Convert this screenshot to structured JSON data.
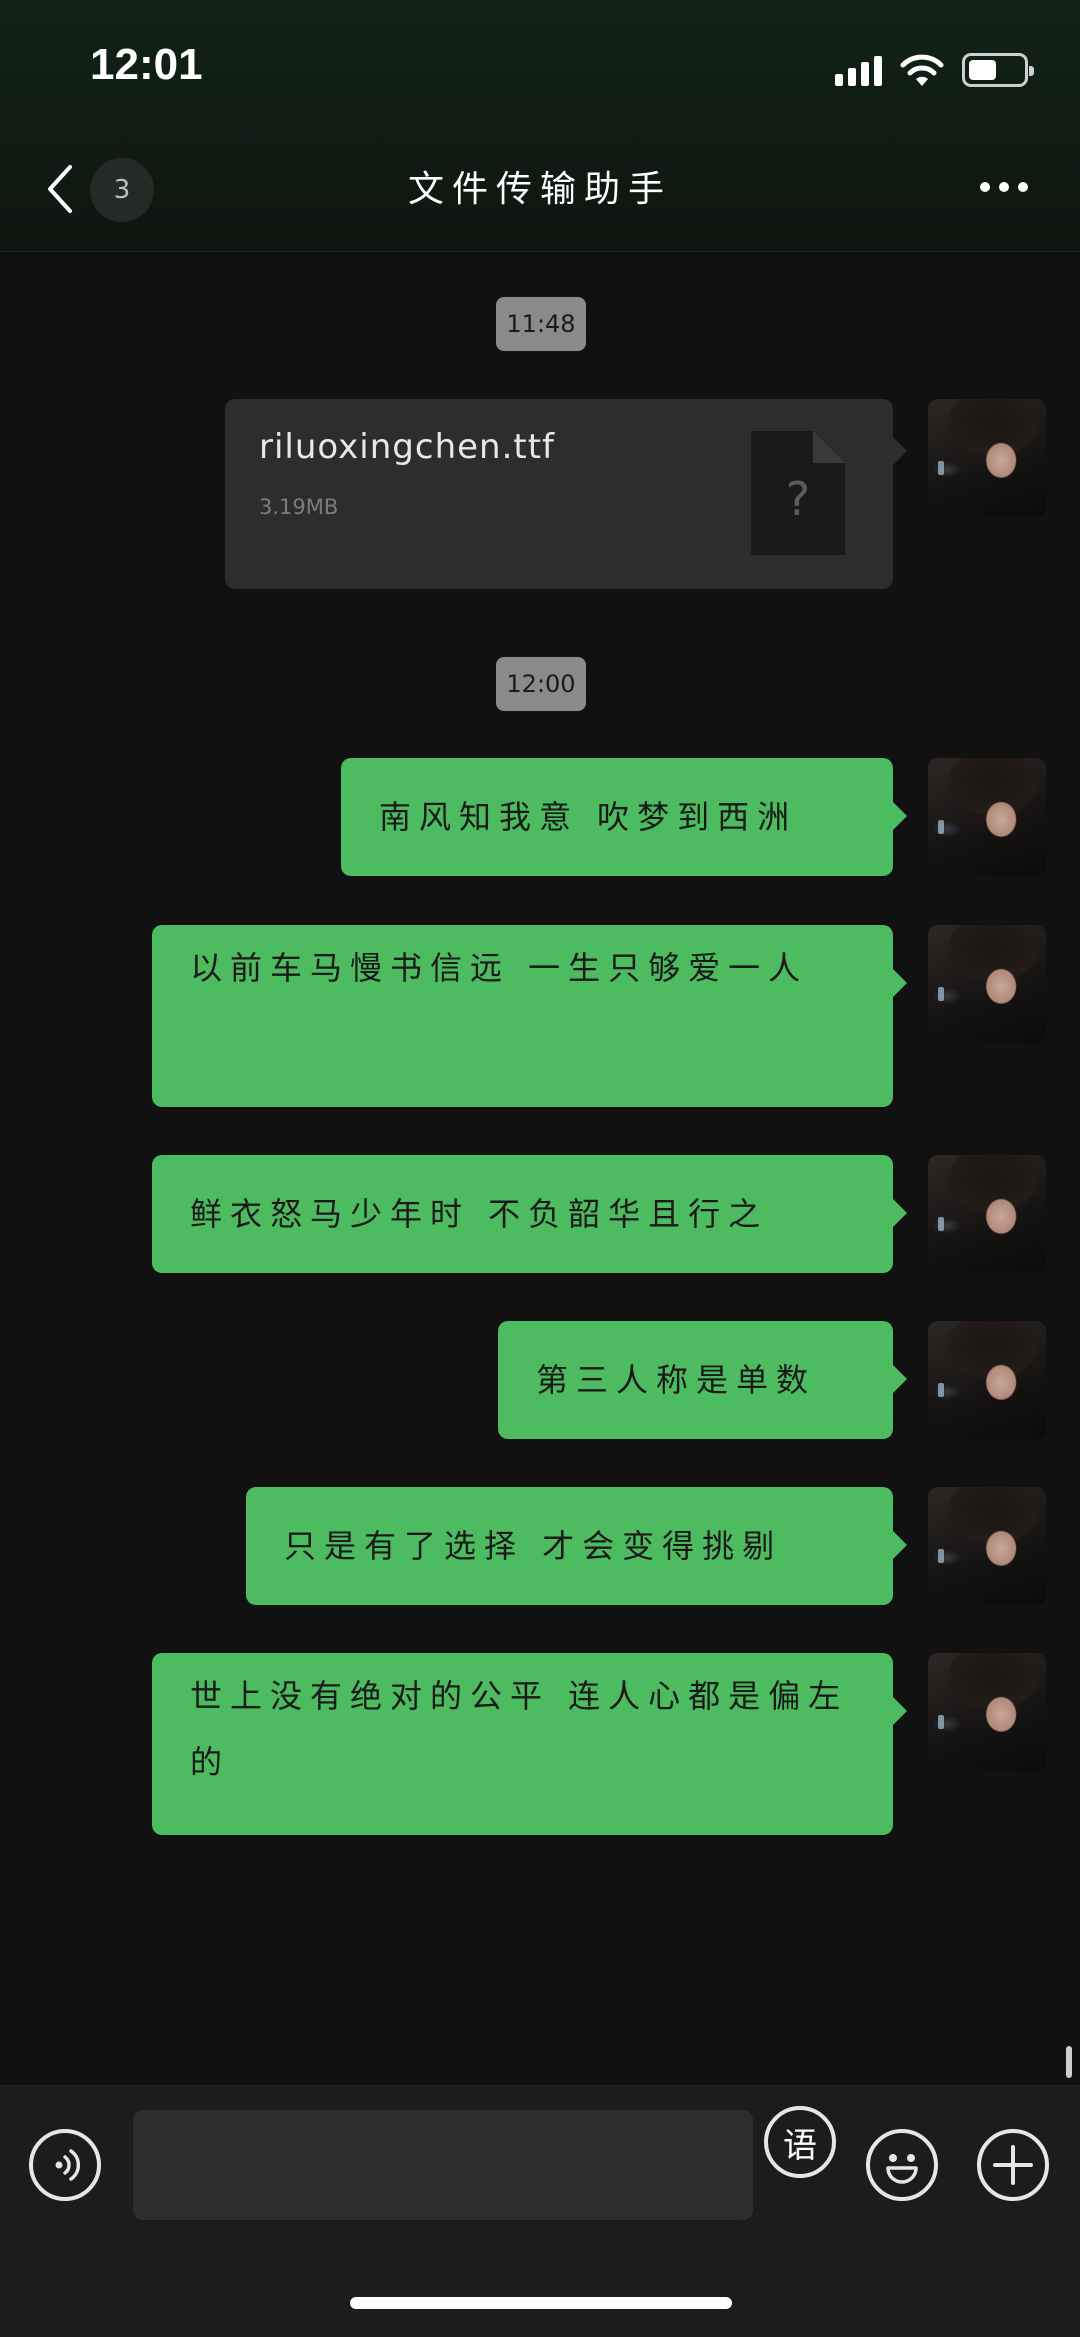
{
  "status_bar": {
    "time": "12:01"
  },
  "header": {
    "back_badge_count": "3",
    "title": "文件传输助手"
  },
  "messages": {
    "time_1": "11:48",
    "file": {
      "name": "riluoxingchen.ttf",
      "size": "3.19MB",
      "icon_symbol": "?"
    },
    "time_2": "12:00",
    "m1": "南风知我意 吹梦到西洲",
    "m2": "以前车马慢书信远 一生只够爱一人",
    "m3": "鲜衣怒马少年时 不负韶华且行之",
    "m4": "第三人称是单数",
    "m5": "只是有了选择 才会变得挑剔",
    "m6": "世上没有绝对的公平 连人心都是偏左的"
  },
  "input_bar": {
    "placeholder": "",
    "voice_to_text_label": "语"
  },
  "colors": {
    "bubble_green": "#4dbb5f",
    "background": "#111111",
    "file_card": "#2d2d2d"
  },
  "icons": [
    "back-chevron-icon",
    "more-dots-icon",
    "voice-icon",
    "emoji-icon",
    "plus-icon",
    "file-unknown-icon"
  ]
}
